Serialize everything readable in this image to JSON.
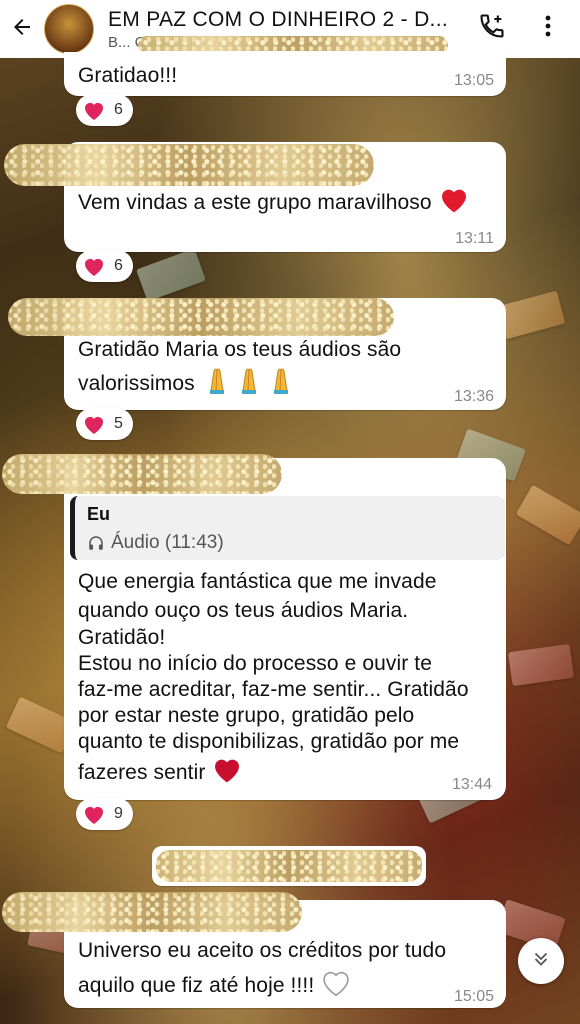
{
  "header": {
    "title": "EM PAZ COM O DINHEIRO 2 - D...",
    "subtitle": "B... Conceição Ferr..."
  },
  "messages": [
    {
      "text": "Gratidao!!!",
      "time": "13:05",
      "reaction": {
        "emoji": "heart",
        "count": "6"
      }
    },
    {
      "text": "Vem vindas a este grupo maravilhoso",
      "time": "13:11",
      "trailing_emoji": "red-heart",
      "reaction": {
        "emoji": "heart",
        "count": "6"
      }
    },
    {
      "lines": [
        "Gratidão Maria os teus áudios são",
        "valorissimos"
      ],
      "trailing_emoji": "folded-hands x3",
      "time": "13:36",
      "reaction": {
        "emoji": "heart",
        "count": "5"
      }
    },
    {
      "quote": {
        "author": "Eu",
        "body": "Áudio (11:43)"
      },
      "lines": [
        "Que energia fantástica que me invade",
        "quando ouço os teus áudios Maria.",
        "Gratidão!",
        "Estou no início do processo e ouvir te",
        "faz-me acreditar, faz-me sentir... Gratidão",
        "por estar neste grupo, gratidão pelo",
        "quanto te disponibilizas, gratidão por me",
        "fazeres sentir"
      ],
      "trailing_emoji": "red-heart",
      "time": "13:44",
      "reaction": {
        "emoji": "heart",
        "count": "9"
      }
    },
    {
      "lines": [
        "Universo eu aceito os créditos por tudo",
        "aquilo que fiz até hoje !!!!"
      ],
      "trailing_emoji": "white-heart",
      "time": "15:05"
    }
  ],
  "colors": {
    "bubble": "#ffffff",
    "heart": "#e0245e",
    "time": "#888888"
  },
  "icons": {
    "back": "arrow-left-icon",
    "call": "add-call-icon",
    "menu": "more-vert-icon",
    "scroll": "double-chevron-down-icon",
    "audio": "headphones-icon"
  }
}
